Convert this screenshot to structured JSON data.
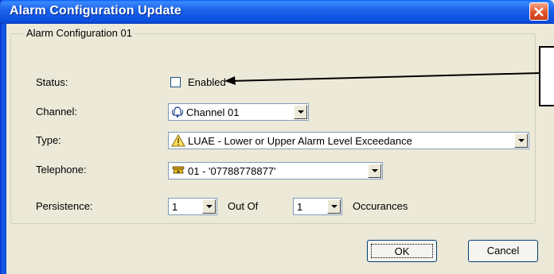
{
  "window": {
    "title": "Alarm Configuration Update"
  },
  "group": {
    "label": "Alarm Configuration 01"
  },
  "status": {
    "label": "Status:",
    "checkbox_label": "Enabled",
    "checked": false
  },
  "channel": {
    "label": "Channel:",
    "value": "Channel 01"
  },
  "type": {
    "label": "Type:",
    "value": "LUAE - Lower or Upper Alarm Level Exceedance"
  },
  "telephone": {
    "label": "Telephone:",
    "value": "01  -  '07788778877'"
  },
  "persistence": {
    "label": "Persistence:",
    "value": "1",
    "out_of_label": "Out Of",
    "occurrences_value": "1",
    "occurrences_label": "Occurances"
  },
  "buttons": {
    "ok": "OK",
    "cancel": "Cancel"
  },
  "icons": {
    "close": "close-icon",
    "channel": "bell-channel-icon",
    "type": "warning-triangle-icon",
    "telephone": "telephone-icon"
  },
  "colors": {
    "title_bar": "#1b64e8",
    "close_button": "#e0532a",
    "dialog_bg": "#ece9d8"
  }
}
